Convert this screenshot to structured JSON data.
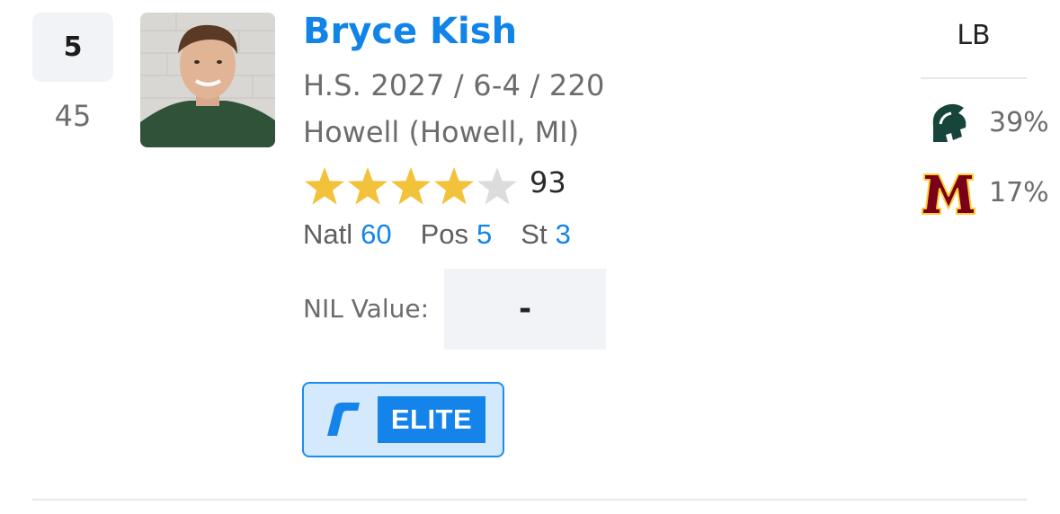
{
  "player": {
    "rank": "5",
    "previous_rank": "45",
    "name": "Bryce Kish",
    "details": "H.S. 2027 / 6-4 / 220",
    "school": "Howell (Howell, MI)",
    "stars": 4,
    "max_stars": 5,
    "rating": "93",
    "national_label": "Natl",
    "national_value": "60",
    "position_label": "Pos",
    "position_value": "5",
    "state_label": "St",
    "state_value": "3",
    "nil_label": "NIL Value:",
    "nil_value": "-",
    "badge_text": "ELITE",
    "position": "LB"
  },
  "predictions": [
    {
      "team_icon": "michigan-state-spartan-icon",
      "percent": "39%",
      "color": "#18453b"
    },
    {
      "team_icon": "minnesota-m-icon",
      "percent": "17%",
      "color": "#7a0019"
    }
  ],
  "colors": {
    "accent": "#1284e8",
    "star_filled": "#f2c23b",
    "star_empty": "#dcdcdc",
    "badge_bg": "#d4e9fc"
  }
}
